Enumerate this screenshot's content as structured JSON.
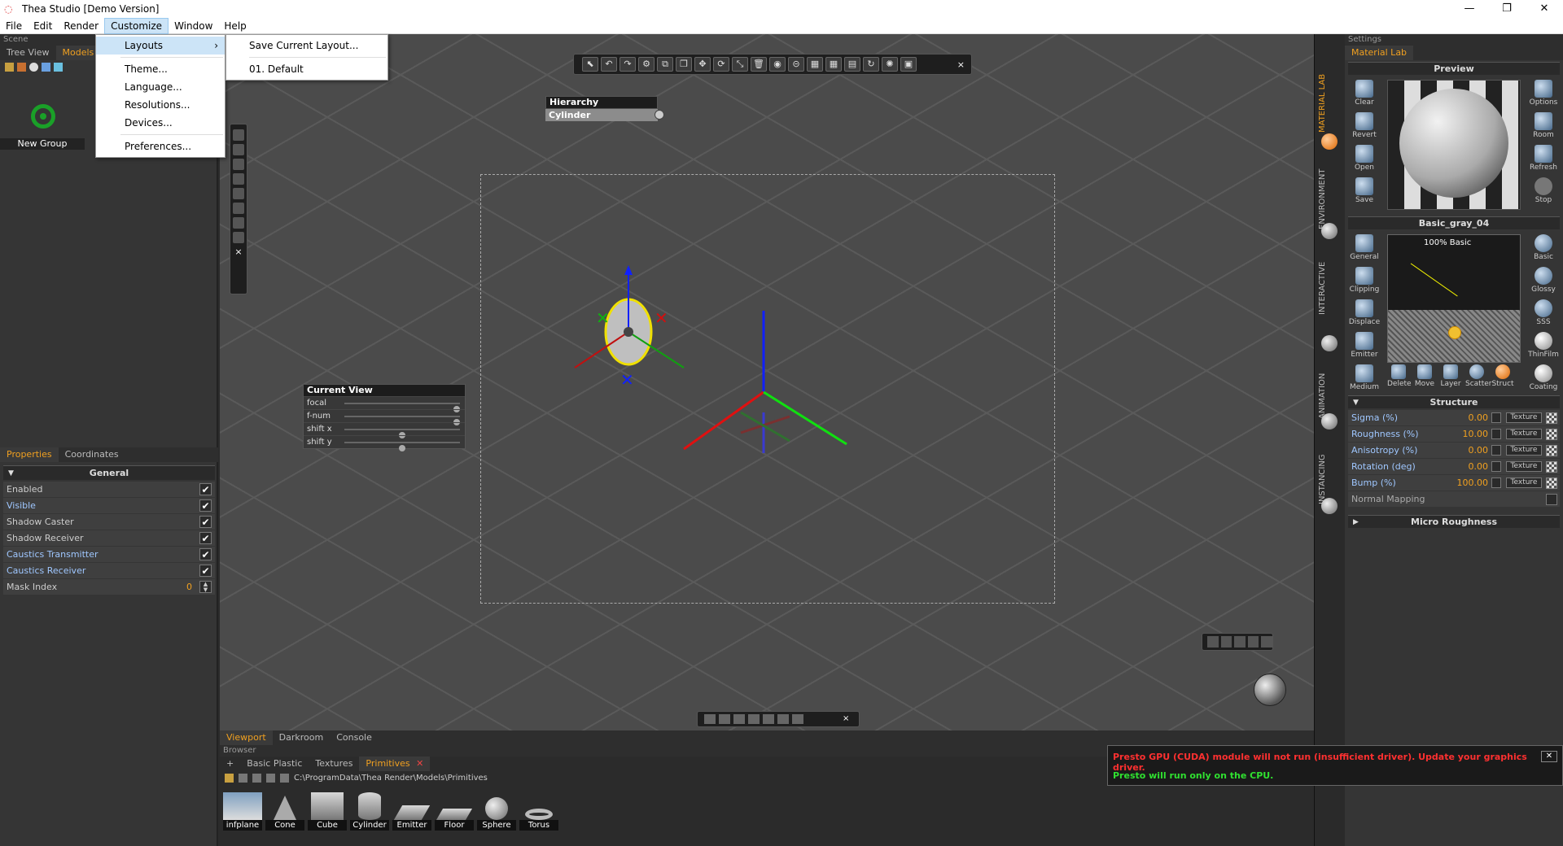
{
  "window": {
    "title": "Thea Studio [Demo Version]",
    "minimize": "—",
    "maximize": "❐",
    "close": "✕"
  },
  "menubar": {
    "items": [
      "File",
      "Edit",
      "Render",
      "Customize",
      "Window",
      "Help"
    ],
    "active": "Customize"
  },
  "customize_menu": {
    "items": [
      "Layouts",
      "Theme...",
      "Language...",
      "Resolutions...",
      "Devices...",
      "Preferences..."
    ],
    "highlighted": "Layouts"
  },
  "layouts_submenu": {
    "items": [
      "Save Current Layout...",
      "01. Default"
    ]
  },
  "scene_panel": {
    "caption": "Scene",
    "tabs": [
      "Tree View",
      "Models"
    ],
    "active_tab": "Models",
    "group_label": "New Group"
  },
  "properties_panel": {
    "tabs": [
      "Properties",
      "Coordinates"
    ],
    "active_tab": "Properties",
    "section": "General",
    "rows": [
      {
        "label": "Enabled",
        "checked": true,
        "link": false
      },
      {
        "label": "Visible",
        "checked": true,
        "link": true
      },
      {
        "label": "Shadow Caster",
        "checked": true,
        "link": false
      },
      {
        "label": "Shadow Receiver",
        "checked": true,
        "link": false
      },
      {
        "label": "Caustics Transmitter",
        "checked": true,
        "link": true
      },
      {
        "label": "Caustics Receiver",
        "checked": true,
        "link": true
      }
    ],
    "mask_index": {
      "label": "Mask Index",
      "value": "0"
    },
    "check_glyph": "✔"
  },
  "viewport": {
    "hierarchy": {
      "title": "Hierarchy",
      "item": "Cylinder"
    },
    "current_view": {
      "title": "Current View",
      "rows": [
        {
          "label": "focal",
          "knob": 0.97
        },
        {
          "label": "f-num",
          "knob": 0.97
        },
        {
          "label": "shift x",
          "knob": 0.5
        },
        {
          "label": "shift y",
          "knob": 0.5
        }
      ]
    },
    "toolbar_close": "×",
    "tabs": [
      "Viewport",
      "Darkroom",
      "Console"
    ],
    "active_tab": "Viewport"
  },
  "browser": {
    "caption": "Browser",
    "tabs": [
      "+",
      "Basic Plastic",
      "Textures",
      "Primitives"
    ],
    "active_tab": "Primitives",
    "tab_close": "✕",
    "path": "C:\\ProgramData\\Thea Render\\Models\\Primitives",
    "primitives": [
      "infplane",
      "Cone",
      "Cube",
      "Cylinder",
      "Emitter",
      "Floor",
      "Sphere",
      "Torus"
    ]
  },
  "warning": {
    "line1": "Presto GPU (CUDA) module will not run (insufficient driver). Update your graphics driver.",
    "line2": "Presto will run only on the CPU.",
    "close": "✕",
    "color1": "#ff3030",
    "color2": "#30e030"
  },
  "side_tabs": [
    "MATERIAL LAB",
    "ENVIRONMENT",
    "INTERACTIVE",
    "ANIMATION",
    "INSTANCING"
  ],
  "settings_panel": {
    "caption": "Settings",
    "tab": "Material Lab",
    "preview_title": "Preview",
    "left_buttons": [
      "Clear",
      "Revert",
      "Open",
      "Save"
    ],
    "right_buttons": [
      "Options",
      "Room",
      "Refresh",
      "Stop"
    ],
    "material_name": "Basic_gray_04",
    "layer_label": "100% Basic",
    "left_layer_buttons": [
      "General",
      "Clipping",
      "Displace",
      "Emitter",
      "Medium"
    ],
    "right_layer_buttons": [
      "Basic",
      "Glossy",
      "SSS",
      "ThinFilm",
      "Coating"
    ],
    "bottom_buttons": [
      "Delete",
      "Move",
      "Layer",
      "Scatter",
      "Struct"
    ],
    "structure_title": "Structure",
    "structure_rows": [
      {
        "label": "Sigma (%)",
        "value": "0.00"
      },
      {
        "label": "Roughness (%)",
        "value": "10.00"
      },
      {
        "label": "Anisotropy (%)",
        "value": "0.00"
      },
      {
        "label": "Rotation (deg)",
        "value": "0.00"
      },
      {
        "label": "Bump (%)",
        "value": "100.00"
      }
    ],
    "texture_label": "Texture",
    "normal_mapping": "Normal Mapping",
    "micro_roughness": "Micro Roughness"
  },
  "accent_color": "#f0a020"
}
